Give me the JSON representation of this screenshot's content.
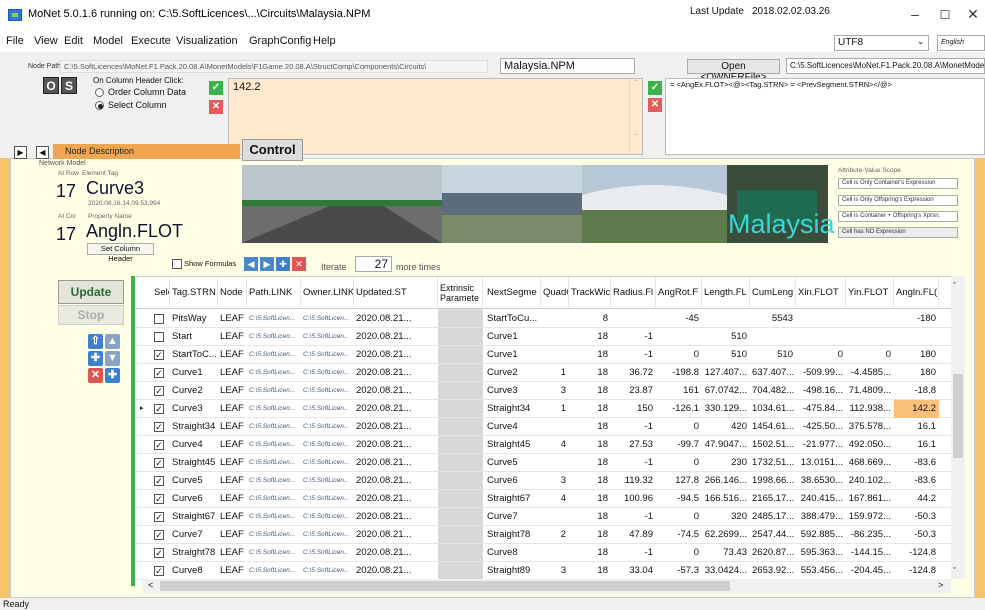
{
  "window": {
    "title": "MoNet 5.0.1.6 running on: C:\\5.SoftLicences\\...\\Circuits\\Malaysia.NPM"
  },
  "menu": {
    "items": [
      "File",
      "View",
      "Edit",
      "Model",
      "Execute",
      "Visualization",
      "GraphConfig",
      "Help"
    ]
  },
  "header": {
    "last_update_label": "Last Update",
    "last_update_value": "2018.02.02.03.26",
    "encoding": "UTF8",
    "language": "English"
  },
  "nodepath": {
    "label": "Node Path",
    "value": "C:\\5.SoftLicences\\MoNet.F1.Pack.20.08.A\\MonetModels\\F1Game.20.08.A\\StructComp\\Components\\Circuits\\",
    "node_name": "Malaysia.NPM",
    "owner_button": "Open <OWNERFile>",
    "owner_path": "C:\\5.SoftLicences\\MoNet.F1.Pack.20.08.A\\MonetModels"
  },
  "column_click": {
    "label": "On Column Header Click:",
    "option1": "Order Column Data",
    "option2": "Select Column",
    "btn_o": "O",
    "btn_s": "S"
  },
  "expression": {
    "value": "142.2",
    "formula": "= <AngEx.FLOT><@><Tag.STRN> = <PrevSegment.STRN></@>"
  },
  "model": {
    "network_label": "Network Model",
    "node_description": "Node Description",
    "control_label": "Control"
  },
  "element": {
    "at_row_label": "At Row",
    "element_tag_label": "Element Tag",
    "row_number": "17",
    "element_tag": "Curve3",
    "timestamp": "2020.08.16.14.09.53.994",
    "at_col_label": "At Col",
    "property_name_label": "Property Name",
    "col_number": "17",
    "property_name": "Angln.FLOT",
    "set_column_header": "Set Column Header"
  },
  "banner": {
    "text": "Malaysia"
  },
  "scope": {
    "title": "Attribute-Value Scope",
    "items": [
      "Cell is Only Container's Expression",
      "Cell is Only Offspring's Expression",
      "Cell is Container + Offspring's Xprsn.",
      "Cell has NO Expression"
    ]
  },
  "iteration": {
    "show_formulas": "Show Formulas",
    "iterate_label": "Iterate",
    "iterate_value": "27",
    "more_times": "more times"
  },
  "buttons": {
    "update": "Update",
    "stop": "Stop"
  },
  "grid": {
    "columns": [
      "Sele",
      "Tag.STRN",
      "Node",
      "Path.LINK",
      "Owner.LINK",
      "Updated.ST",
      "Extrinsic Paramete",
      "NextSegme",
      "QuadC",
      "TrackWic",
      "Radius.Fl",
      "AngRot.F",
      "Length.FL",
      "CumLeng",
      "Xin.FLOT",
      "Yin.FLOT",
      "Angln.FL("
    ],
    "rows": [
      {
        "sel": false,
        "tag": "PitsWay",
        "node": "LEAF",
        "path": "C:\\5.SoftLicen...",
        "owner": "C:\\5.SoftLicen...",
        "upd": "2020.08.21...",
        "next": "StartToCu...",
        "quad": "",
        "track": "8",
        "radius": "",
        "angrot": "-45",
        "length": "",
        "cum": "5543",
        "xin": "",
        "yin": "",
        "angin": "-180",
        "current": false
      },
      {
        "sel": false,
        "tag": "Start",
        "node": "LEAF",
        "path": "C:\\5.SoftLicen...",
        "owner": "C:\\5.SoftLicen...",
        "upd": "2020.08.21...",
        "next": "Curve1",
        "quad": "",
        "track": "18",
        "radius": "-1",
        "angrot": "",
        "length": "510",
        "cum": "",
        "xin": "",
        "yin": "",
        "angin": "",
        "current": false
      },
      {
        "sel": true,
        "tag": "StartToC...",
        "node": "LEAF",
        "path": "C:\\5.SoftLicen...",
        "owner": "C:\\5.SoftLicen...",
        "upd": "2020.08.21...",
        "next": "Curve1",
        "quad": "",
        "track": "18",
        "radius": "-1",
        "angrot": "0",
        "length": "510",
        "cum": "510",
        "xin": "0",
        "yin": "0",
        "angin": "180",
        "current": false
      },
      {
        "sel": true,
        "tag": "Curve1",
        "node": "LEAF",
        "path": "C:\\5.SoftLicen...",
        "owner": "C:\\5.SoftLicen...",
        "upd": "2020.08.21...",
        "next": "Curve2",
        "quad": "1",
        "track": "18",
        "radius": "36.72",
        "angrot": "-198.8",
        "length": "127.407...",
        "cum": "637.407...",
        "xin": "-509.99...",
        "yin": "-4.4585...",
        "angin": "180",
        "current": false
      },
      {
        "sel": true,
        "tag": "Curve2",
        "node": "LEAF",
        "path": "C:\\5.SoftLicen...",
        "owner": "C:\\5.SoftLicen...",
        "upd": "2020.08.21...",
        "next": "Curve3",
        "quad": "3",
        "track": "18",
        "radius": "23.87",
        "angrot": "161",
        "length": "67.0742...",
        "cum": "704.482...",
        "xin": "-498.16...",
        "yin": "71.4809...",
        "angin": "-18.8",
        "current": false
      },
      {
        "sel": true,
        "tag": "Curve3",
        "node": "LEAF",
        "path": "C:\\5.SoftLicen...",
        "owner": "C:\\5.SoftLicen...",
        "upd": "2020.08.21...",
        "next": "Straight34",
        "quad": "1",
        "track": "18",
        "radius": "150",
        "angrot": "-126.1",
        "length": "330.129...",
        "cum": "1034.61...",
        "xin": "-475.84...",
        "yin": "112.938...",
        "angin": "142.2",
        "current": true
      },
      {
        "sel": true,
        "tag": "Straight34",
        "node": "LEAF",
        "path": "C:\\5.SoftLicen...",
        "owner": "C:\\5.SoftLicen...",
        "upd": "2020.08.21...",
        "next": "Curve4",
        "quad": "",
        "track": "18",
        "radius": "-1",
        "angrot": "0",
        "length": "420",
        "cum": "1454.61...",
        "xin": "-425.50...",
        "yin": "375.578...",
        "angin": "16.1",
        "current": false
      },
      {
        "sel": true,
        "tag": "Curve4",
        "node": "LEAF",
        "path": "C:\\5.SoftLicen...",
        "owner": "C:\\5.SoftLicen...",
        "upd": "2020.08.21...",
        "next": "Straight45",
        "quad": "4",
        "track": "18",
        "radius": "27.53",
        "angrot": "-99.7",
        "length": "47.9047...",
        "cum": "1502.51...",
        "xin": "-21.977...",
        "yin": "492.050...",
        "angin": "16.1",
        "current": false
      },
      {
        "sel": true,
        "tag": "Straight45",
        "node": "LEAF",
        "path": "C:\\5.SoftLicen...",
        "owner": "C:\\5.SoftLicen...",
        "upd": "2020.08.21...",
        "next": "Curve5",
        "quad": "",
        "track": "18",
        "radius": "-1",
        "angrot": "0",
        "length": "230",
        "cum": "1732.51...",
        "xin": "13.0151...",
        "yin": "468.669...",
        "angin": "-83.6",
        "current": false
      },
      {
        "sel": true,
        "tag": "Curve5",
        "node": "LEAF",
        "path": "C:\\5.SoftLicen...",
        "owner": "C:\\5.SoftLicen...",
        "upd": "2020.08.21...",
        "next": "Curve6",
        "quad": "3",
        "track": "18",
        "radius": "119.32",
        "angrot": "127.8",
        "length": "266.146...",
        "cum": "1998.66...",
        "xin": "38.6530...",
        "yin": "240.102...",
        "angin": "-83.6",
        "current": false
      },
      {
        "sel": true,
        "tag": "Curve6",
        "node": "LEAF",
        "path": "C:\\5.SoftLicen...",
        "owner": "C:\\5.SoftLicen...",
        "upd": "2020.08.21...",
        "next": "Straight67",
        "quad": "4",
        "track": "18",
        "radius": "100.96",
        "angrot": "-94.5",
        "length": "166.516...",
        "cum": "2165.17...",
        "xin": "240.415...",
        "yin": "167.861...",
        "angin": "44.2",
        "current": false
      },
      {
        "sel": true,
        "tag": "Straight67",
        "node": "LEAF",
        "path": "C:\\5.SoftLicen...",
        "owner": "C:\\5.SoftLicen...",
        "upd": "2020.08.21...",
        "next": "Curve7",
        "quad": "",
        "track": "18",
        "radius": "-1",
        "angrot": "0",
        "length": "320",
        "cum": "2485.17...",
        "xin": "388.479...",
        "yin": "159.972...",
        "angin": "-50.3",
        "current": false
      },
      {
        "sel": true,
        "tag": "Curve7",
        "node": "LEAF",
        "path": "C:\\5.SoftLicen...",
        "owner": "C:\\5.SoftLicen...",
        "upd": "2020.08.21...",
        "next": "Straight78",
        "quad": "2",
        "track": "18",
        "radius": "47.89",
        "angrot": "-74.5",
        "length": "62.2699...",
        "cum": "2547.44...",
        "xin": "592.885...",
        "yin": "-86.235...",
        "angin": "-50.3",
        "current": false
      },
      {
        "sel": true,
        "tag": "Straight78",
        "node": "LEAF",
        "path": "C:\\5.SoftLicen...",
        "owner": "C:\\5.SoftLicen...",
        "upd": "2020.08.21...",
        "next": "Curve8",
        "quad": "",
        "track": "18",
        "radius": "-1",
        "angrot": "0",
        "length": "73.43",
        "cum": "2620.87...",
        "xin": "595.363...",
        "yin": "-144.15...",
        "angin": "-124.8",
        "current": false
      },
      {
        "sel": true,
        "tag": "Curve8",
        "node": "LEAF",
        "path": "C:\\5.SoftLicen...",
        "owner": "C:\\5.SoftLicen...",
        "upd": "2020.08.21...",
        "next": "Straight89",
        "quad": "3",
        "track": "18",
        "radius": "33.04",
        "angrot": "-57.3",
        "length": "33.0424...",
        "cum": "2653.92...",
        "xin": "553.456...",
        "yin": "-204.45...",
        "angin": "-124.8",
        "current": false
      }
    ]
  },
  "status": {
    "text": "Ready"
  },
  "colors": {
    "accent_orange": "#f0a650",
    "grid_green": "#3cb34a",
    "expr_bg": "#ffe8cc",
    "current_cell": "#fbbf7c"
  }
}
